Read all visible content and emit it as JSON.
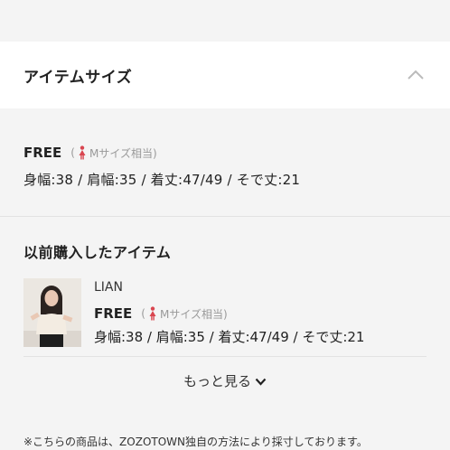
{
  "accordion": {
    "title": "アイテムサイズ",
    "toggle_icon": "chevron-up-icon"
  },
  "size": {
    "label": "FREE",
    "note_prefix": "(",
    "note_text": "Mサイズ相当)",
    "person_icon": "female-figure-icon",
    "measurements": "身幅:38 / 肩幅:35 / 着丈:47/49 / そで丈:21"
  },
  "previous": {
    "title": "以前購入したアイテム",
    "item": {
      "brand": "LIAN",
      "size_label": "FREE",
      "note_prefix": "(",
      "note_text": "Mサイズ相当)",
      "measurements": "身幅:38 / 肩幅:35 / 着丈:47/49 / そで丈:21"
    },
    "more_label": "もっと見る",
    "more_icon": "chevron-down-icon"
  },
  "footnote": "※こちらの商品は、ZOZOTOWN独自の方法により採寸しております。",
  "colors": {
    "person_icon": "#d9454f",
    "background": "#f4f4f4",
    "panel": "#ffffff"
  }
}
